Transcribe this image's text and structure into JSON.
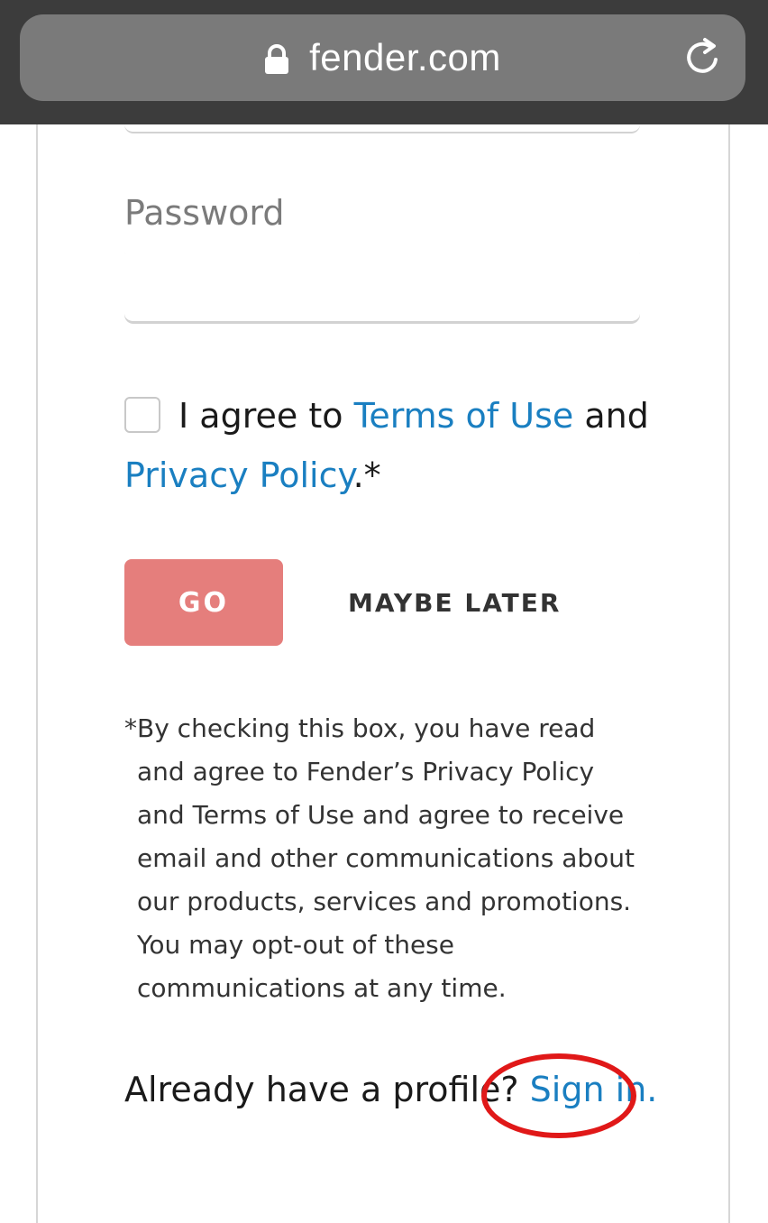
{
  "browser": {
    "url": "fender.com",
    "lock_icon": "lock-icon",
    "reload_icon": "reload-icon"
  },
  "form": {
    "password_label": "Password",
    "password_value": "",
    "agree": {
      "prefix": "I agree to",
      "terms_link": "Terms of Use",
      "and": "and",
      "privacy_link": "Privacy Policy",
      "suffix": ".*",
      "checked": false
    },
    "go_button": "GO",
    "maybe_later": "MAYBE LATER",
    "disclaimer_star": "*",
    "disclaimer": "By checking this box, you have read and agree to Fender’s Privacy Policy and Terms of Use and agree to receive email and other communications about our products, services and promotions. You may opt-out of these communications at any time.",
    "already_text": "Already have a profile?",
    "sign_in_link": "Sign in."
  },
  "colors": {
    "link": "#1a7fc1",
    "go_button": "#e57e7c",
    "annotation": "#e01818"
  }
}
